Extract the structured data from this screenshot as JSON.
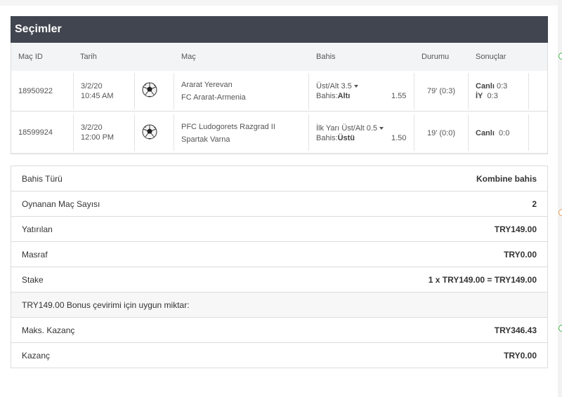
{
  "selections": {
    "title": "Seçimler",
    "columns": {
      "match_id": "Maç ID",
      "date": "Tarih",
      "match": "Maç",
      "bet": "Bahis",
      "status": "Durumu",
      "results": "Sonuçlar"
    },
    "rows": [
      {
        "match_id": "18950922",
        "date": "3/2/20",
        "time": "10:45 AM",
        "sport_icon": "soccer-ball-icon",
        "home": "Ararat Yerevan",
        "away": "FC Ararat-Armenia",
        "market": "Üst/Alt 3.5",
        "pick_label": "Bahis:",
        "pick": "Altı",
        "odds": "1.55",
        "status": "79' (0:3)",
        "result1_label": "Canlı",
        "result1_value": "0:3",
        "result2_label": "İY",
        "result2_value": "0:3"
      },
      {
        "match_id": "18599924",
        "date": "3/2/20",
        "time": "12:00 PM",
        "sport_icon": "soccer-ball-icon",
        "home": "PFC Ludogorets Razgrad II",
        "away": "Spartak Varna",
        "market": "İlk Yarı Üst/Alt 0.5",
        "pick_label": "Bahis:",
        "pick": "Üstü",
        "odds": "1.50",
        "status": "19' (0:0)",
        "result1_label": "Canlı",
        "result1_value": "0:0"
      }
    ]
  },
  "summary": {
    "bet_type": {
      "label": "Bahis Türü",
      "value": "Kombine bahis"
    },
    "match_count": {
      "label": "Oynanan Maç Sayısı",
      "value": "2"
    },
    "deposited": {
      "label": "Yatırılan",
      "value": "TRY149.00"
    },
    "fee": {
      "label": "Masraf",
      "value": "TRY0.00"
    },
    "stake": {
      "label": "Stake",
      "value": "1 x TRY149.00 = TRY149.00"
    },
    "bonus_note": "TRY149.00 Bonus çevirimi için uygun miktar:",
    "max_win": {
      "label": "Maks. Kazanç",
      "value": "TRY346.43"
    },
    "win": {
      "label": "Kazanç",
      "value": "TRY0.00"
    }
  },
  "colors": {
    "header_bg": "#40454f",
    "accent_green": "#46b04a",
    "accent_orange": "#e4985a"
  }
}
